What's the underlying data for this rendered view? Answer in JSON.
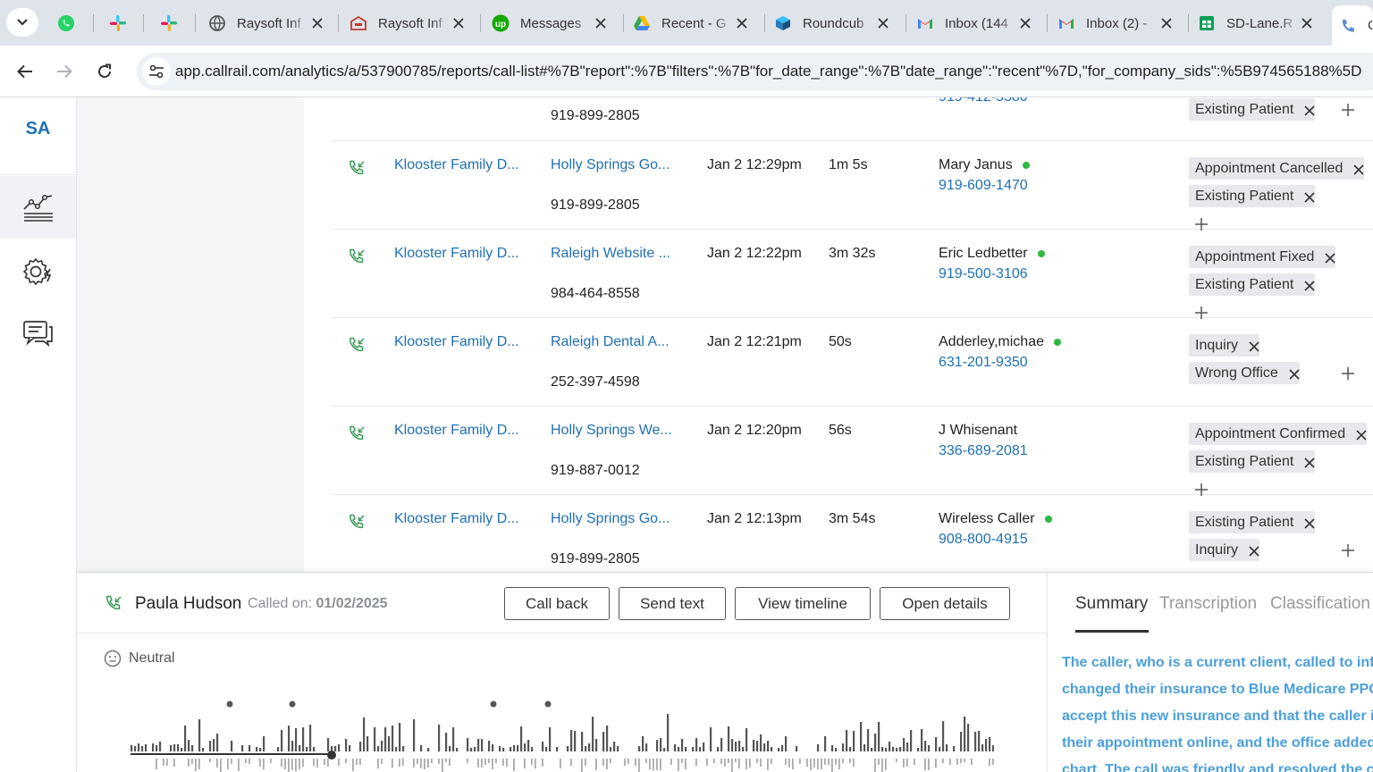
{
  "browser": {
    "tabs": [
      {
        "title": "",
        "icon": "whatsapp-icon"
      },
      {
        "title": "",
        "icon": "slack-icon"
      },
      {
        "title": "",
        "icon": "slack-icon"
      },
      {
        "title": "Raysoft Inf",
        "icon": "globe-icon"
      },
      {
        "title": "Raysoft Inf",
        "icon": "raysoft-icon"
      },
      {
        "title": "Messages",
        "icon": "upwork-icon"
      },
      {
        "title": "Recent - G",
        "icon": "drive-icon"
      },
      {
        "title": "Roundcub",
        "icon": "roundcube-icon"
      },
      {
        "title": "Inbox (144",
        "icon": "gmail-icon"
      },
      {
        "title": "Inbox (2) -",
        "icon": "gmail-icon"
      },
      {
        "title": "SD-Lane.R",
        "icon": "sheets-icon"
      },
      {
        "title": "C",
        "icon": "callrail-icon"
      }
    ],
    "url": "app.callrail.com/analytics/a/537900785/reports/call-list#%7B\"report\":%7B\"filters\":%7B\"for_date_range\":%7B\"date_range\":\"recent\"%7D,\"for_company_sids\":%5B974565188%5D"
  },
  "nav": {
    "initials": "SA",
    "items": [
      "analytics-icon",
      "settings-icon",
      "messages-icon"
    ]
  },
  "top_partial_row": {
    "tracking": "919-899-2805",
    "phone": "919-412-5380",
    "tags": [
      "Existing Patient"
    ]
  },
  "calls": [
    {
      "company": "Klooster Family D...",
      "source": "Holly Springs Go...",
      "tracking": "919-899-2805",
      "date": "Jan 2 12:29pm",
      "duration": "1m 5s",
      "name": "Mary Janus",
      "phone": "919-609-1470",
      "dot": true,
      "tags": [
        "Appointment Cancelled",
        "Existing Patient"
      ]
    },
    {
      "company": "Klooster Family D...",
      "source": "Raleigh Website ...",
      "tracking": "984-464-8558",
      "date": "Jan 2 12:22pm",
      "duration": "3m 32s",
      "name": "Eric Ledbetter",
      "phone": "919-500-3106",
      "dot": true,
      "tags": [
        "Appointment Fixed",
        "Existing Patient"
      ]
    },
    {
      "company": "Klooster Family D...",
      "source": "Raleigh Dental A...",
      "tracking": "252-397-4598",
      "date": "Jan 2 12:21pm",
      "duration": "50s",
      "name": "Adderley,michae",
      "phone": "631-201-9350",
      "dot": true,
      "tags": [
        "Inquiry",
        "Wrong Office"
      ]
    },
    {
      "company": "Klooster Family D...",
      "source": "Holly Springs We...",
      "tracking": "919-887-0012",
      "date": "Jan 2 12:20pm",
      "duration": "56s",
      "name": "J Whisenant",
      "phone": "336-689-2081",
      "dot": false,
      "tags": [
        "Appointment Confirmed",
        "Existing Patient"
      ]
    },
    {
      "company": "Klooster Family D...",
      "source": "Holly Springs Go...",
      "tracking": "919-899-2805",
      "date": "Jan 2 12:13pm",
      "duration": "3m 54s",
      "name": "Wireless Caller",
      "phone": "908-800-4915",
      "dot": true,
      "tags": [
        "Existing Patient",
        "Inquiry"
      ]
    }
  ],
  "detail": {
    "caller_name": "Paula Hudson",
    "called_on_label": "Called on:",
    "called_on_date": "01/02/2025",
    "buttons": {
      "call_back": "Call back",
      "send_text": "Send text",
      "view_timeline": "View timeline",
      "open_details": "Open details"
    },
    "sentiment": "Neutral",
    "tabs": [
      "Summary",
      "Transcription",
      "Classification"
    ],
    "summary_lines": [
      "The caller, who is a current client, called to info",
      "changed their insurance to Blue Medicare PPO",
      "accept this new insurance and that the caller is",
      "their appointment online, and the office added",
      "chart. The call was friendly and resolved the ca"
    ]
  },
  "colors": {
    "link": "#1f6fb5",
    "status_dot": "#2eb83f",
    "summary_text": "#4a9fdc",
    "tag_bg": "#e6e8eb"
  }
}
